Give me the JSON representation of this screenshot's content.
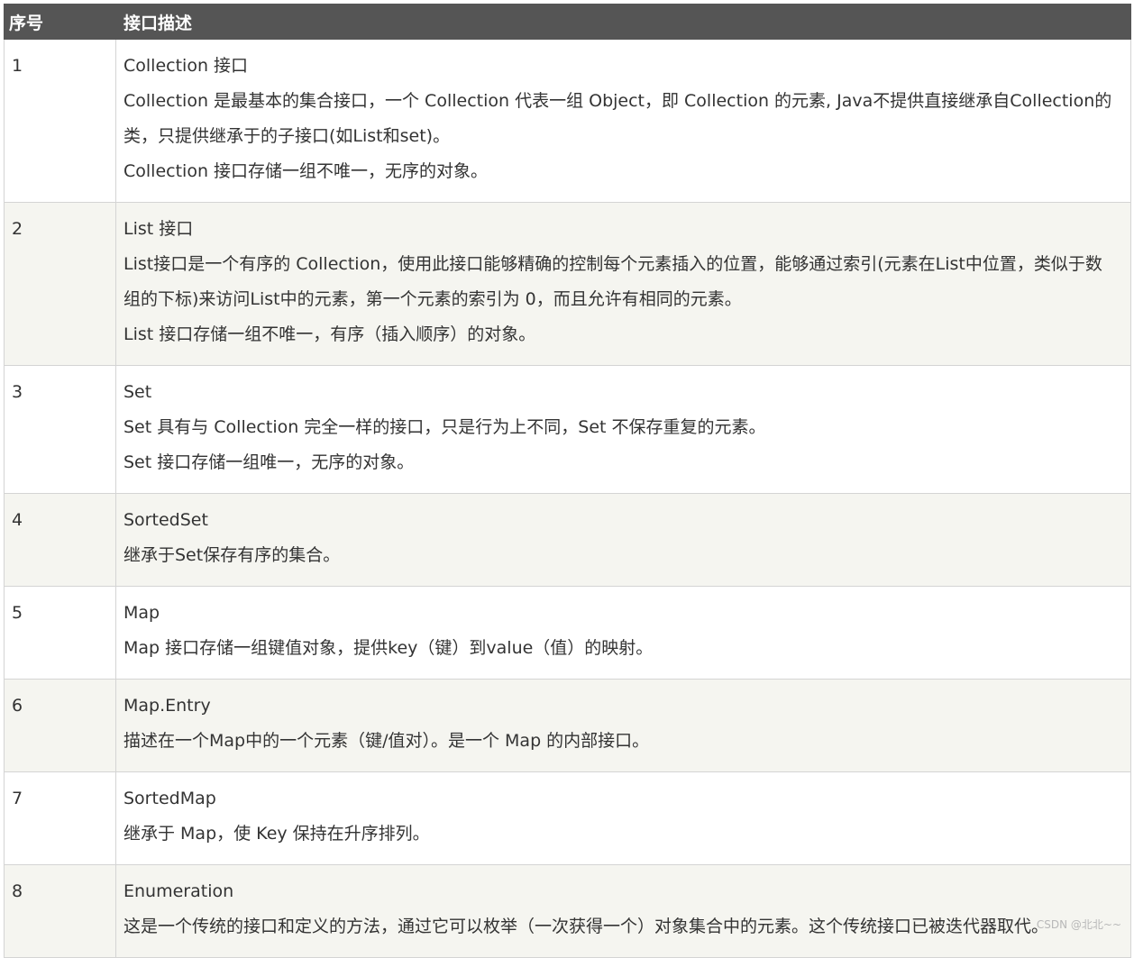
{
  "header": {
    "col_num": "序号",
    "col_desc": "接口描述"
  },
  "rows": [
    {
      "num": "1",
      "lines": [
        "Collection 接口",
        "Collection 是最基本的集合接口，一个 Collection 代表一组 Object，即 Collection 的元素, Java不提供直接继承自Collection的类，只提供继承于的子接口(如List和set)。",
        "Collection 接口存储一组不唯一，无序的对象。"
      ]
    },
    {
      "num": "2",
      "lines": [
        "List 接口",
        "List接口是一个有序的 Collection，使用此接口能够精确的控制每个元素插入的位置，能够通过索引(元素在List中位置，类似于数组的下标)来访问List中的元素，第一个元素的索引为 0，而且允许有相同的元素。",
        "List 接口存储一组不唯一，有序（插入顺序）的对象。"
      ]
    },
    {
      "num": "3",
      "lines": [
        "Set",
        "Set 具有与 Collection 完全一样的接口，只是行为上不同，Set 不保存重复的元素。",
        "Set 接口存储一组唯一，无序的对象。"
      ]
    },
    {
      "num": "4",
      "lines": [
        "SortedSet",
        "继承于Set保存有序的集合。"
      ]
    },
    {
      "num": "5",
      "lines": [
        "Map",
        "Map 接口存储一组键值对象，提供key（键）到value（值）的映射。"
      ]
    },
    {
      "num": "6",
      "lines": [
        "Map.Entry",
        "描述在一个Map中的一个元素（键/值对）。是一个 Map 的内部接口。"
      ]
    },
    {
      "num": "7",
      "lines": [
        "SortedMap",
        "继承于 Map，使 Key 保持在升序排列。"
      ]
    },
    {
      "num": "8",
      "lines": [
        "Enumeration",
        "这是一个传统的接口和定义的方法，通过它可以枚举（一次获得一个）对象集合中的元素。这个传统接口已被迭代器取代。"
      ]
    }
  ],
  "watermark": "CSDN @北北~~"
}
